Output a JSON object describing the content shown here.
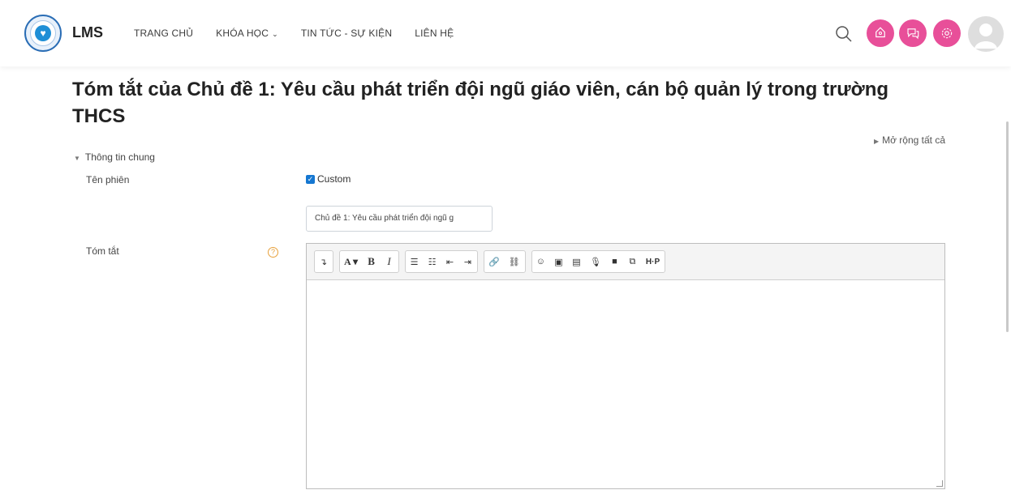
{
  "header": {
    "brand": "LMS",
    "nav": [
      {
        "label": "TRANG CHỦ"
      },
      {
        "label": "KHÓA HỌC",
        "has_dropdown": true
      },
      {
        "label": "TIN TỨC - SỰ KIỆN"
      },
      {
        "label": "LIÊN HỆ"
      }
    ],
    "icons": [
      "search-icon",
      "notification-icon",
      "messages-icon",
      "settings-icon",
      "avatar"
    ],
    "accent_color": "#e84f99",
    "dropdown_glyph": "⌄"
  },
  "page": {
    "title": "Tóm tắt của Chủ đề 1: Yêu cầu phát triển đội ngũ giáo viên, cán bộ quản lý trong trường THCS",
    "expand_all": "Mở rộng tất cả",
    "section_title": "Thông tin chung"
  },
  "form": {
    "name_label": "Tên phiên",
    "custom_label": "Custom",
    "custom_checked": true,
    "name_value": "Chủ đề 1: Yêu cầu phát triển đội ngũ g",
    "summary_label": "Tóm tắt",
    "help_glyph": "?"
  },
  "editor": {
    "toolbar": {
      "collapse": "↴",
      "font": "A ▾",
      "bold": "B",
      "italic": "I",
      "ul": "☰",
      "ol": "☷",
      "indent": "⇤",
      "outdent": "⇥",
      "link": "🔗",
      "unlink": "⛓",
      "emoji": "☺",
      "image": "▣",
      "media": "▤",
      "audio": "🎙",
      "video": "■",
      "copy": "⧉",
      "h5p": "H·P"
    },
    "content": ""
  }
}
